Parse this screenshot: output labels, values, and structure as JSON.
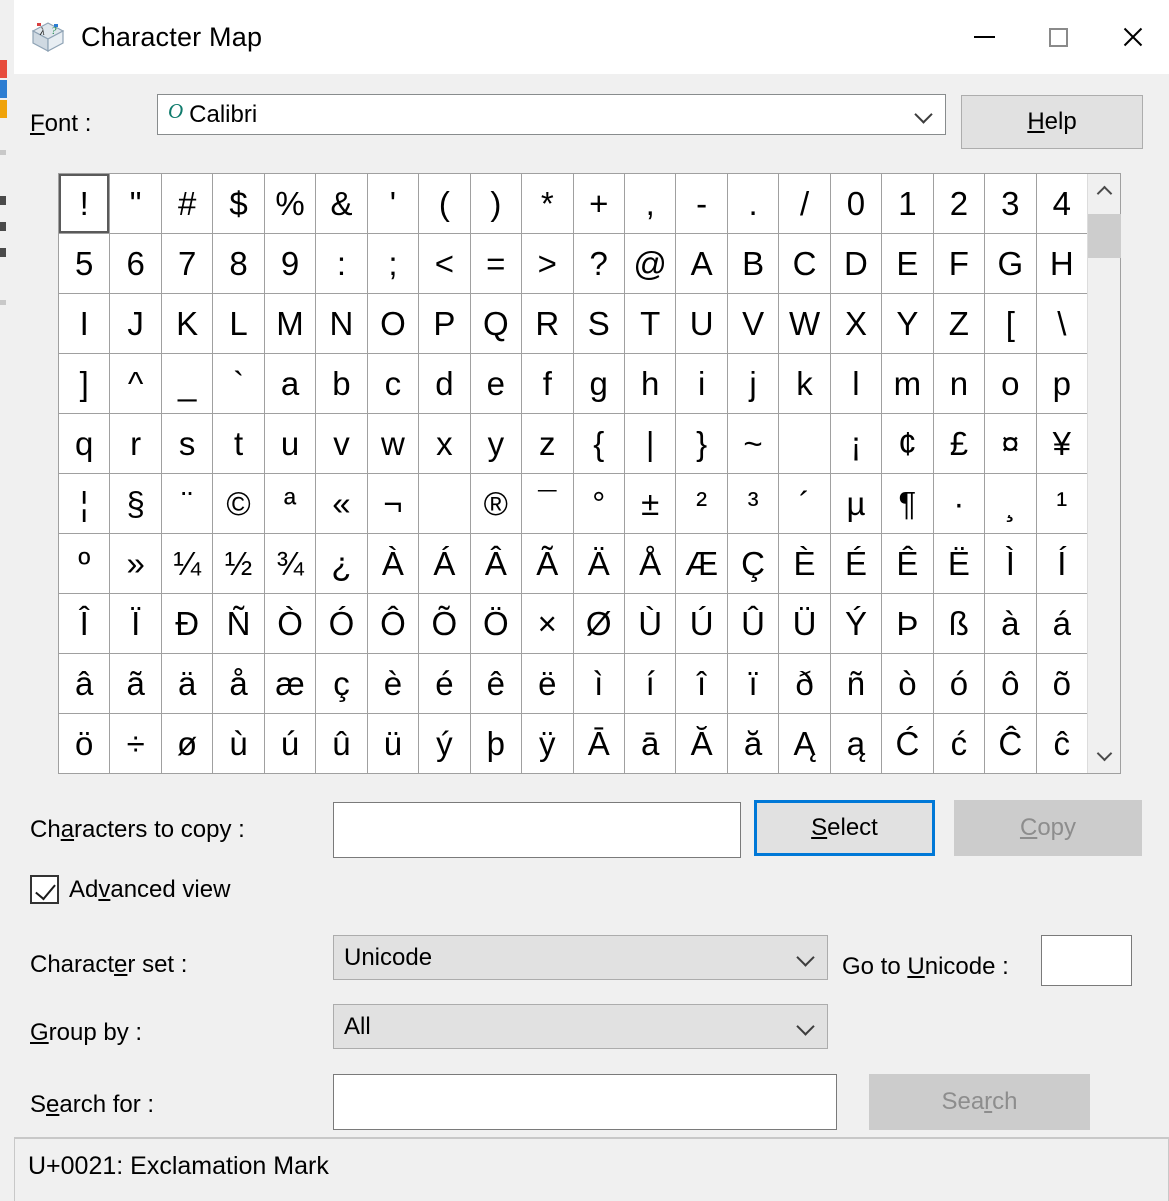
{
  "window": {
    "title": "Character Map",
    "icon": "character-map-icon",
    "controls": {
      "minimize": "minimize-icon",
      "maximize": "maximize-icon",
      "close": "close-icon"
    }
  },
  "font_row": {
    "label": "Font :",
    "label_accel": "F",
    "value": "Calibri",
    "value_icon": "opentype-icon",
    "help_label": "Help",
    "help_accel": "H"
  },
  "grid": {
    "selected_index": 0,
    "rows": [
      [
        "!",
        "\"",
        "#",
        "$",
        "%",
        "&",
        "'",
        "(",
        ")",
        "*",
        "+",
        ",",
        "-",
        ".",
        "/",
        "0",
        "1",
        "2",
        "3",
        "4"
      ],
      [
        "5",
        "6",
        "7",
        "8",
        "9",
        ":",
        ";",
        "<",
        "=",
        ">",
        "?",
        "@",
        "A",
        "B",
        "C",
        "D",
        "E",
        "F",
        "G",
        "H"
      ],
      [
        "I",
        "J",
        "K",
        "L",
        "M",
        "N",
        "O",
        "P",
        "Q",
        "R",
        "S",
        "T",
        "U",
        "V",
        "W",
        "X",
        "Y",
        "Z",
        "[",
        "\\"
      ],
      [
        "]",
        "^",
        "_",
        "`",
        "a",
        "b",
        "c",
        "d",
        "e",
        "f",
        "g",
        "h",
        "i",
        "j",
        "k",
        "l",
        "m",
        "n",
        "o",
        "p"
      ],
      [
        "q",
        "r",
        "s",
        "t",
        "u",
        "v",
        "w",
        "x",
        "y",
        "z",
        "{",
        "|",
        "}",
        "~",
        " ",
        "¡",
        "¢",
        "£",
        "¤",
        "¥"
      ],
      [
        "¦",
        "§",
        "¨",
        "©",
        "ª",
        "«",
        "¬",
        "­",
        "®",
        "¯",
        "°",
        "±",
        "²",
        "³",
        "´",
        "µ",
        "¶",
        "·",
        "¸",
        "¹"
      ],
      [
        "º",
        "»",
        "¼",
        "½",
        "¾",
        "¿",
        "À",
        "Á",
        "Â",
        "Ã",
        "Ä",
        "Å",
        "Æ",
        "Ç",
        "È",
        "É",
        "Ê",
        "Ë",
        "Ì",
        "Í"
      ],
      [
        "Î",
        "Ï",
        "Ð",
        "Ñ",
        "Ò",
        "Ó",
        "Ô",
        "Õ",
        "Ö",
        "×",
        "Ø",
        "Ù",
        "Ú",
        "Û",
        "Ü",
        "Ý",
        "Þ",
        "ß",
        "à",
        "á"
      ],
      [
        "â",
        "ã",
        "ä",
        "å",
        "æ",
        "ç",
        "è",
        "é",
        "ê",
        "ë",
        "ì",
        "í",
        "î",
        "ï",
        "ð",
        "ñ",
        "ò",
        "ó",
        "ô",
        "õ"
      ],
      [
        "ö",
        "÷",
        "ø",
        "ù",
        "ú",
        "û",
        "ü",
        "ý",
        "þ",
        "ÿ",
        "Ā",
        "ā",
        "Ă",
        "ă",
        "Ą",
        "ą",
        "Ć",
        "ć",
        "Ĉ",
        "ĉ"
      ]
    ],
    "scrollbar": {
      "up_icon": "chevron-up-icon",
      "down_icon": "chevron-down-icon"
    }
  },
  "copy_row": {
    "label": "Characters to copy :",
    "label_accel": "a",
    "value": "",
    "select_label": "Select",
    "select_accel": "S",
    "copy_label": "Copy",
    "copy_accel": "C",
    "copy_disabled": true
  },
  "advanced_view": {
    "label": "Advanced view",
    "label_accel": "v",
    "checked": true
  },
  "charset_row": {
    "label": "Character set :",
    "label_accel": "e",
    "value": "Unicode",
    "goto_label": "Go to Unicode :",
    "goto_accel": "U",
    "goto_value": ""
  },
  "groupby_row": {
    "label": "Group by :",
    "label_accel": "G",
    "value": "All"
  },
  "search_row": {
    "label": "Search for :",
    "label_accel": "e",
    "value": "",
    "button_label": "Search",
    "button_accel": "r",
    "button_disabled": true
  },
  "statusbar": {
    "text": "U+0021: Exclamation Mark"
  },
  "colors": {
    "accent": "#0078d7",
    "window_bg": "#f0f0f0",
    "grid_line": "#a0a0a0",
    "opentype": "#0f7b6c"
  }
}
